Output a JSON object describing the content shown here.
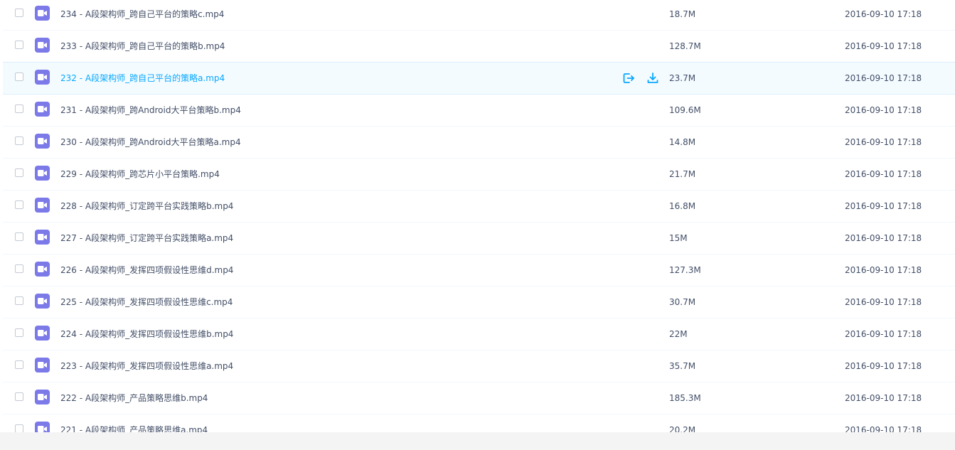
{
  "files": [
    {
      "name": "234 - A段架构师_跨自己平台的策略c.mp4",
      "size": "18.7M",
      "date": "2016-09-10 17:18",
      "icon": "video-file-icon"
    },
    {
      "name": "233 - A段架构师_跨自己平台的策略b.mp4",
      "size": "128.7M",
      "date": "2016-09-10 17:18",
      "icon": "video-file-icon"
    },
    {
      "name": "232 - A段架构师_跨自己平台的策略a.mp4",
      "size": "23.7M",
      "date": "2016-09-10 17:18",
      "icon": "video-file-icon"
    },
    {
      "name": "231 - A段架构师_跨Android大平台策略b.mp4",
      "size": "109.6M",
      "date": "2016-09-10 17:18",
      "icon": "video-file-icon"
    },
    {
      "name": "230 - A段架构师_跨Android大平台策略a.mp4",
      "size": "14.8M",
      "date": "2016-09-10 17:18",
      "icon": "video-file-icon"
    },
    {
      "name": "229 - A段架构师_跨芯片小平台策略.mp4",
      "size": "21.7M",
      "date": "2016-09-10 17:18",
      "icon": "video-file-icon"
    },
    {
      "name": "228 - A段架构师_订定跨平台实践策略b.mp4",
      "size": "16.8M",
      "date": "2016-09-10 17:18",
      "icon": "video-file-icon"
    },
    {
      "name": "227 - A段架构师_订定跨平台实践策略a.mp4",
      "size": "15M",
      "date": "2016-09-10 17:18",
      "icon": "video-file-icon"
    },
    {
      "name": "226 - A段架构师_发挥四项假设性思维d.mp4",
      "size": "127.3M",
      "date": "2016-09-10 17:18",
      "icon": "video-file-icon"
    },
    {
      "name": "225 - A段架构师_发挥四项假设性思维c.mp4",
      "size": "30.7M",
      "date": "2016-09-10 17:18",
      "icon": "video-file-icon"
    },
    {
      "name": "224 - A段架构师_发挥四项假设性思维b.mp4",
      "size": "22M",
      "date": "2016-09-10 17:18",
      "icon": "video-file-icon"
    },
    {
      "name": "223 - A段架构师_发挥四项假设性思维a.mp4",
      "size": "35.7M",
      "date": "2016-09-10 17:18",
      "icon": "video-file-icon"
    },
    {
      "name": "222 - A段架构师_产品策略思维b.mp4",
      "size": "185.3M",
      "date": "2016-09-10 17:18",
      "icon": "video-file-icon"
    },
    {
      "name": "221 - A段架构师_产品策略思维a.mp4",
      "size": "20.2M",
      "date": "2016-09-10 17:18",
      "icon": "video-file-icon"
    }
  ],
  "hovered_index": 2,
  "row_actions": {
    "share_icon": "share-icon",
    "download_icon": "download-icon"
  },
  "colors": {
    "accent": "#06a7ff",
    "video_icon": "#7c79e8",
    "text": "#424e67",
    "hover_bg": "#f4fbff"
  }
}
